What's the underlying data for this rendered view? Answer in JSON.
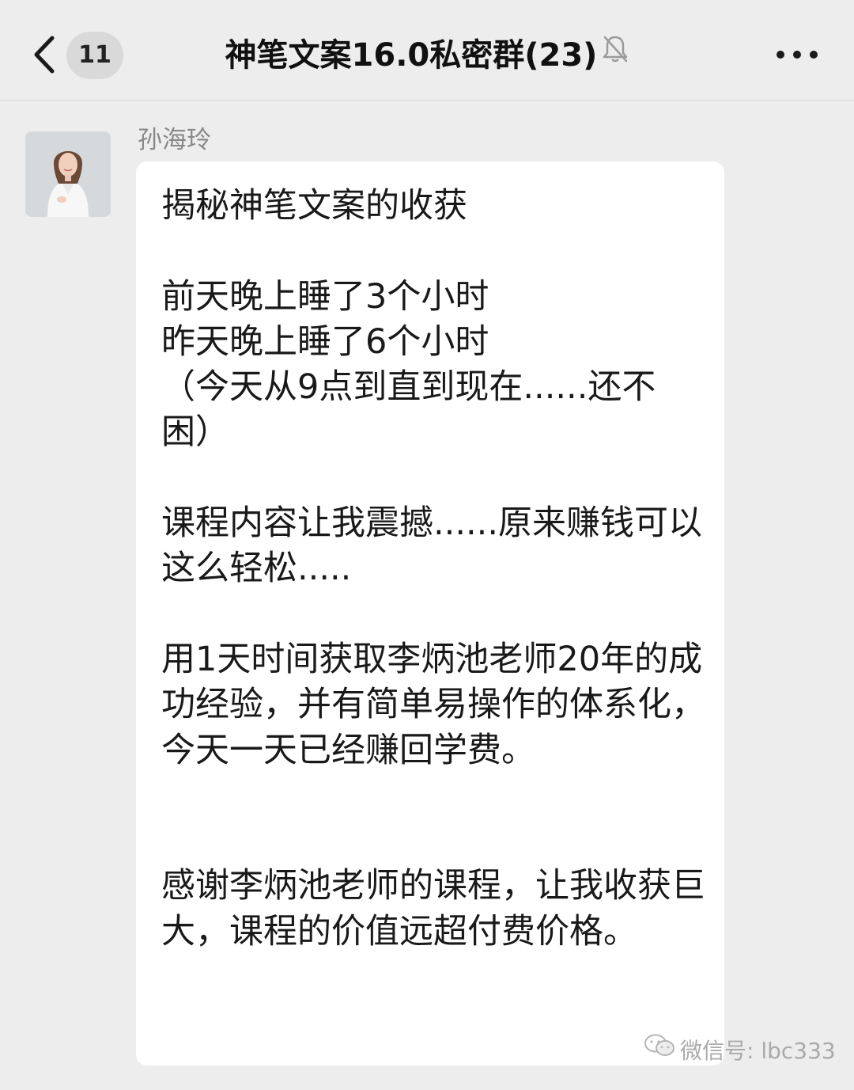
{
  "header": {
    "unread_count": "11",
    "title": "神笔文案16.0私密群(23)",
    "back_icon": "chevron-left-icon",
    "mute_icon": "bell-off-icon",
    "more_icon": "more-dots-icon"
  },
  "message": {
    "sender_name": "孙海玲",
    "text": "揭秘神笔文案的收获\n\n前天晚上睡了3个小时\n昨天晚上睡了6个小时\n（今天从9点到直到现在......还不困）\n\n课程内容让我震撼......原来赚钱可以这么轻松.....\n\n用1天时间获取李炳池老师20年的成功经验，并有简单易操作的体系化，今天一天已经赚回学费。\n\n\n感谢李炳池老师的课程，让我收获巨大，课程的价值远超付费价格。"
  },
  "watermark": {
    "text": "微信号: lbc333"
  },
  "colors": {
    "background": "#ededed",
    "bubble": "#ffffff",
    "sender_name": "#888888"
  }
}
